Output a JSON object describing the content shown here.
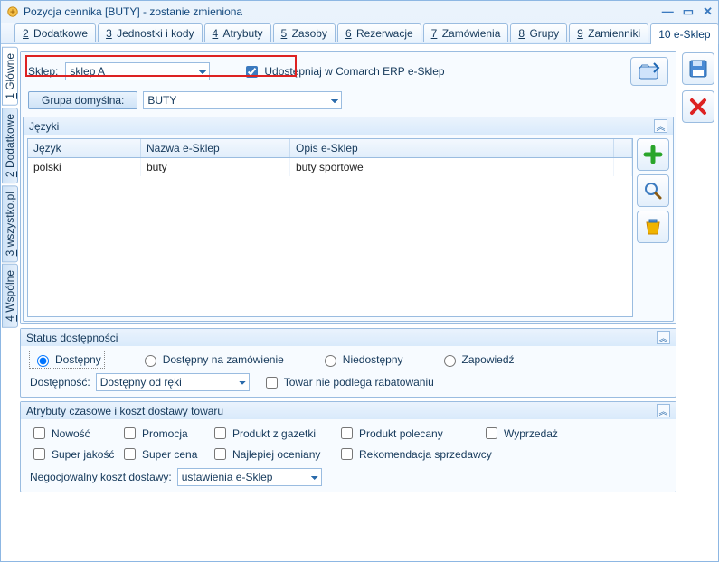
{
  "window": {
    "title": "Pozycja cennika [BUTY] - zostanie zmieniona"
  },
  "tabs": [
    {
      "num": "2",
      "label": "Dodatkowe"
    },
    {
      "num": "3",
      "label": "Jednostki i kody"
    },
    {
      "num": "4",
      "label": "Atrybuty"
    },
    {
      "num": "5",
      "label": "Zasoby"
    },
    {
      "num": "6",
      "label": "Rezerwacje"
    },
    {
      "num": "7",
      "label": "Zamówienia"
    },
    {
      "num": "8",
      "label": "Grupy"
    },
    {
      "num": "9",
      "label": "Zamienniki"
    },
    {
      "num": "10",
      "label": "e-Sklep",
      "active": true
    }
  ],
  "vtabs": [
    {
      "num": "1",
      "label": "Główne",
      "active": true
    },
    {
      "num": "2",
      "label": "Dodatkowe"
    },
    {
      "num": "3",
      "label": "wszystko.pl"
    },
    {
      "num": "4",
      "label": "Wspólne"
    }
  ],
  "top": {
    "sklep_label": "Sklep:",
    "sklep_value": "sklep A",
    "share_label": "Udostępniaj w Comarch ERP e-Sklep",
    "share_checked": true,
    "grupa_btn": "Grupa domyślna:",
    "grupa_value": "BUTY"
  },
  "lang": {
    "section": "Języki",
    "cols": {
      "c1": "Język",
      "c2": "Nazwa e-Sklep",
      "c3": "Opis e-Sklep"
    },
    "rows": [
      {
        "c1": "polski",
        "c2": "buty",
        "c3": "buty sportowe"
      }
    ]
  },
  "status": {
    "section": "Status dostępności",
    "r1": "Dostępny",
    "r2": "Dostępny na zamówienie",
    "r3": "Niedostępny",
    "r4": "Zapowiedź",
    "dost_label": "Dostępność:",
    "dost_value": "Dostępny od ręki",
    "norabat": "Towar nie podlega rabatowaniu"
  },
  "attr": {
    "section": "Atrybuty czasowe i koszt dostawy towaru",
    "c": {
      "a": "Nowość",
      "b": "Promocja",
      "c": "Produkt z gazetki",
      "d": "Produkt polecany",
      "e": "Wyprzedaż",
      "f": "Super jakość",
      "g": "Super cena",
      "h": "Najlepiej oceniany",
      "i": "Rekomendacja sprzedawcy"
    },
    "neg_label": "Negocjowalny koszt dostawy:",
    "neg_value": "ustawienia e-Sklep"
  }
}
